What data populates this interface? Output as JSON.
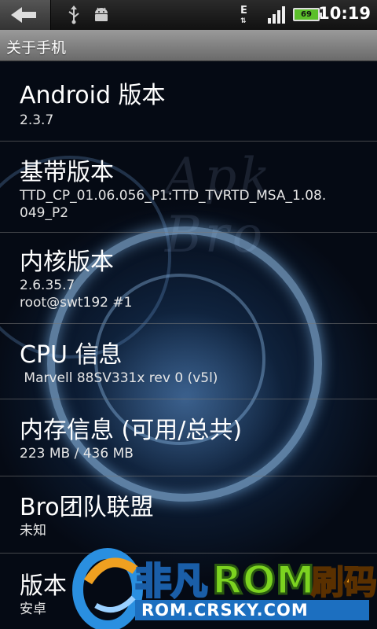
{
  "status_bar": {
    "time": "10:19",
    "battery_level": "69",
    "network_type": "E",
    "icons": [
      "back-arrow-icon",
      "usb-icon",
      "android-debug-icon",
      "data-e-icon",
      "signal-icon",
      "battery-icon"
    ]
  },
  "title_bar": {
    "title": "关于手机"
  },
  "items": [
    {
      "title": "Android 版本",
      "sub": "2.3.7"
    },
    {
      "title": "基带版本",
      "sub": "TTD_CP_01.06.056_P1:TTD_TVRTD_MSA_1.08.\n049_P2"
    },
    {
      "title": "内核版本",
      "sub": "2.6.35.7\nroot@swt192 #1"
    },
    {
      "title": "CPU 信息",
      "sub": " Marvell 88SV331x rev 0 (v5l)"
    },
    {
      "title": "内存信息 (可用/总共)",
      "sub": "223 MB / 436 MB"
    },
    {
      "title": "Bro团队联盟",
      "sub": "未知"
    },
    {
      "title": "版本",
      "sub": "安卓"
    }
  ],
  "wallpaper_text": "Apk  Bro",
  "watermark": {
    "brand": "非凡",
    "rom": "ROM",
    "suffix": "刷码",
    "url": "ROM.CRSKY.COM"
  },
  "colors": {
    "accent_blue": "#2a8fe0",
    "rom_green": "#7cd320",
    "battery_green": "#5bbf2a"
  }
}
